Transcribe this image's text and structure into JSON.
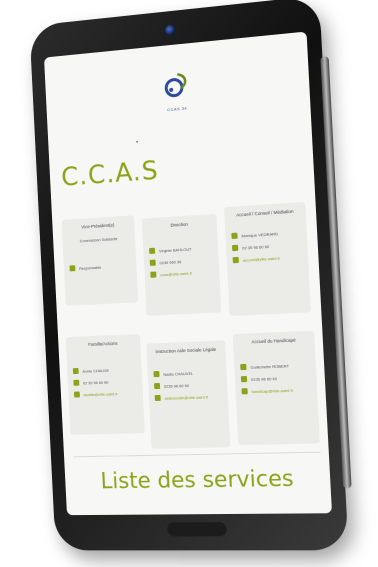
{
  "logo": {
    "text": "CCAS 34"
  },
  "page_title": "C.C.A.S",
  "cards": [
    {
      "title": "Vice-Président(e)",
      "subtitle": "Commission Solidarité",
      "rows": [
        {
          "icon": "user-icon",
          "text": "Responsable"
        }
      ]
    },
    {
      "title": "Direction",
      "rows": [
        {
          "icon": "user-icon",
          "text": "Virginie BAHLOUT"
        },
        {
          "icon": "phone-icon",
          "text": "0235 960 36"
        },
        {
          "icon": "mail-icon",
          "text": "ccas@ville-saint.fr",
          "link": true
        }
      ]
    },
    {
      "title": "Accueil / Conseil / Médiation",
      "rows": [
        {
          "icon": "user-icon",
          "text": "Monique VEDRARD"
        },
        {
          "icon": "phone-icon",
          "text": "02 35 96 60 60"
        },
        {
          "icon": "mail-icon",
          "text": "accueil@ville-saint.fr",
          "link": true
        }
      ]
    },
    {
      "title": "Famille/Actions",
      "rows": [
        {
          "icon": "user-icon",
          "text": "Annie CHAUVE"
        },
        {
          "icon": "phone-icon",
          "text": "02 35 96 60 60"
        },
        {
          "icon": "mail-icon",
          "text": "famille@ville-saint.fr",
          "link": true
        }
      ]
    },
    {
      "title": "Instruction Aide Sociale Légale",
      "rows": [
        {
          "icon": "user-icon",
          "text": "Nadia CHAUVEL"
        },
        {
          "icon": "phone-icon",
          "text": "0235 96 60 60"
        },
        {
          "icon": "mail-icon",
          "text": "aidesociale@ville-saint.fr",
          "link": true
        }
      ]
    },
    {
      "title": "Accueil du Handicapé",
      "rows": [
        {
          "icon": "user-icon",
          "text": "Guillemette ROBERT"
        },
        {
          "icon": "phone-icon",
          "text": "0235 96 60 60"
        },
        {
          "icon": "mail-icon",
          "text": "handicap@ville-saint.fr",
          "link": true
        }
      ]
    }
  ],
  "services_heading": "Liste des services",
  "colors": {
    "accent": "#8aa318",
    "card_bg": "#ebebe8",
    "screen_bg": "#f7f7f5"
  }
}
